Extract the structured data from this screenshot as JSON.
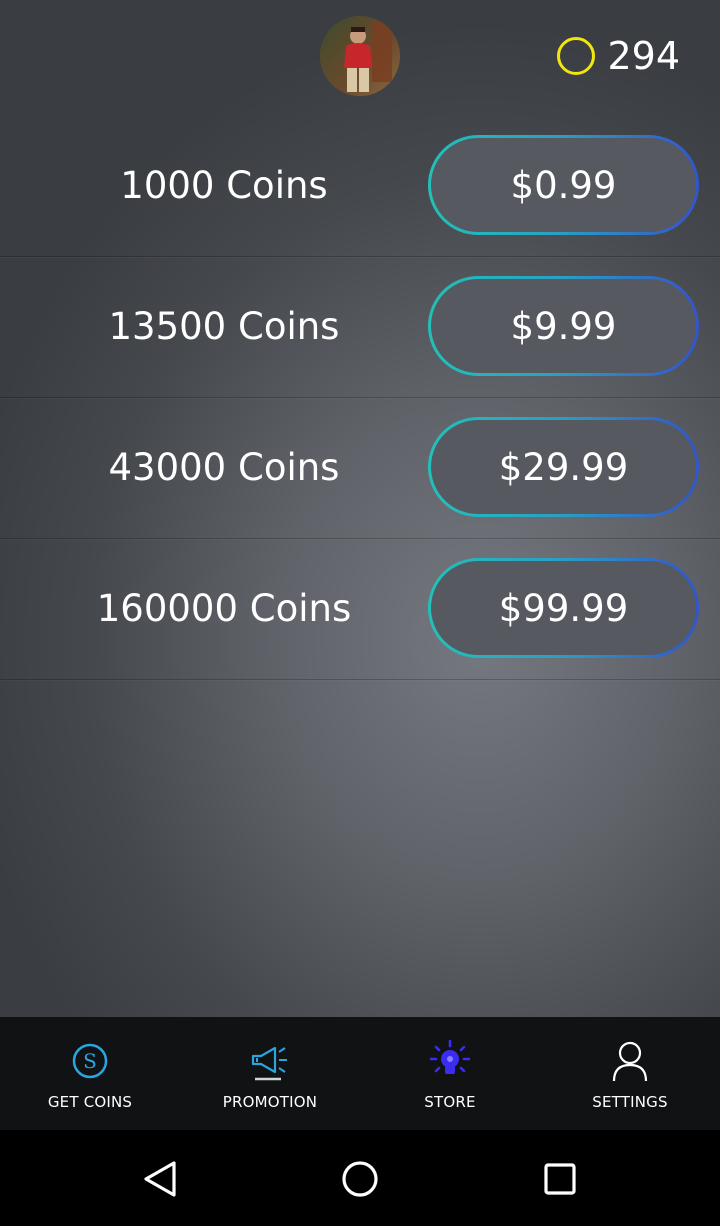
{
  "header": {
    "avatar_icon": "user-avatar-photo",
    "coin_icon": "coin-ring-icon",
    "coin_count": "294",
    "coin_color": "#f2e60f"
  },
  "packages": [
    {
      "amount": "1000 Coins",
      "price": "$0.99"
    },
    {
      "amount": "13500 Coins",
      "price": "$9.99"
    },
    {
      "amount": "43000 Coins",
      "price": "$29.99"
    },
    {
      "amount": "160000 Coins",
      "price": "$99.99"
    }
  ],
  "tabs": [
    {
      "label": "GET COINS",
      "icon": "s-coin-icon",
      "color": "#2aa5e0"
    },
    {
      "label": "PROMOTION",
      "icon": "megaphone-icon",
      "color": "#2aa5e0"
    },
    {
      "label": "STORE",
      "icon": "lightbulb-icon",
      "color": "#3a2df0",
      "selected": true
    },
    {
      "label": "SETTINGS",
      "icon": "person-icon",
      "color": "#ffffff"
    }
  ],
  "navigation": {
    "back_icon": "back-triangle-icon",
    "home_icon": "home-circle-icon",
    "recents_icon": "recents-square-icon"
  },
  "colors": {
    "button_gradient_start": "#22c1b9",
    "button_gradient_end": "#3355c9",
    "tabbar_background": "#111213"
  }
}
